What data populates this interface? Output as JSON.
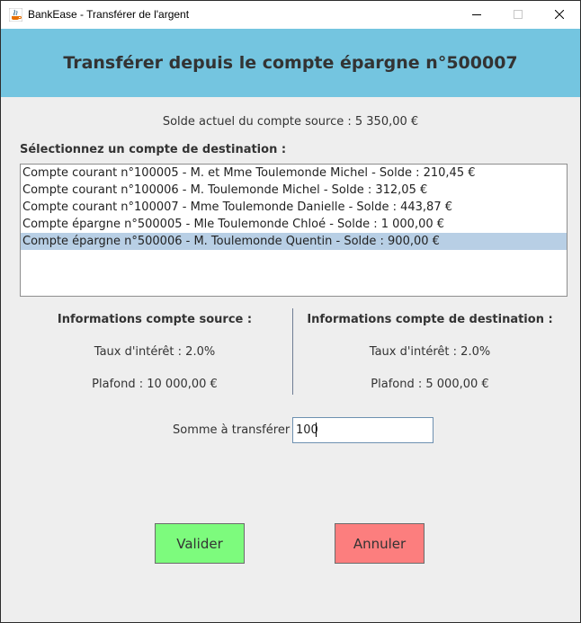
{
  "window": {
    "title": "BankEase - Transférer de l'argent"
  },
  "header": {
    "title": "Transférer depuis le compte épargne n°500007"
  },
  "source_balance": "Solde actuel du compte source : 5 350,00 €",
  "destination": {
    "label": "Sélectionnez un compte de destination :",
    "selected_index": 4,
    "items": [
      "Compte courant n°100005 - M. et Mme Toulemonde Michel - Solde : 210,45 €",
      "Compte courant n°100006 - M. Toulemonde Michel - Solde : 312,05 €",
      "Compte courant n°100007 - Mme Toulemonde Danielle - Solde : 443,87 €",
      "Compte épargne n°500005 - Mle Toulemonde Chloé - Solde : 1 000,00 €",
      "Compte épargne n°500006 - M. Toulemonde Quentin - Solde : 900,00 €"
    ]
  },
  "source_info": {
    "heading": "Informations compte source :",
    "rate": "Taux d'intérêt : 2.0%",
    "ceiling": "Plafond : 10 000,00 €"
  },
  "destination_info": {
    "heading": "Informations compte de destination :",
    "rate": "Taux d'intérêt : 2.0%",
    "ceiling": "Plafond : 5 000,00 €"
  },
  "amount": {
    "label": "Somme à transférer :",
    "value": "100"
  },
  "buttons": {
    "validate": "Valider",
    "cancel": "Annuler"
  },
  "colors": {
    "header_bg": "#74c5e0",
    "selection_bg": "#b8cfe5",
    "validate_bg": "#7dfb7d",
    "cancel_bg": "#fc7e7e"
  }
}
